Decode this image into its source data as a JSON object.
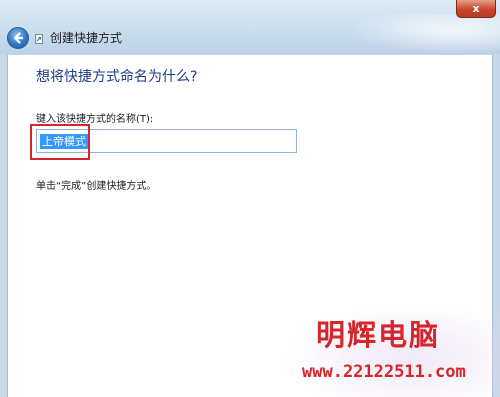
{
  "window": {
    "close_label": "x",
    "title": "创建快捷方式"
  },
  "wizard": {
    "heading": "想将快捷方式命名为什么?",
    "name_field_label": "键入该快捷方式的名称(T):",
    "name_field_value": "上帝模式",
    "hint": "单击“完成”创建快捷方式。"
  },
  "watermark": {
    "title": "明辉电脑",
    "url": "www.22122511.com"
  },
  "colors": {
    "accent_blue": "#1f3b8a",
    "selection": "#3399ff",
    "annotation_red": "#d4262b"
  },
  "icons": {
    "back": "back-arrow-icon",
    "wizard": "shortcut-wizard-icon"
  }
}
